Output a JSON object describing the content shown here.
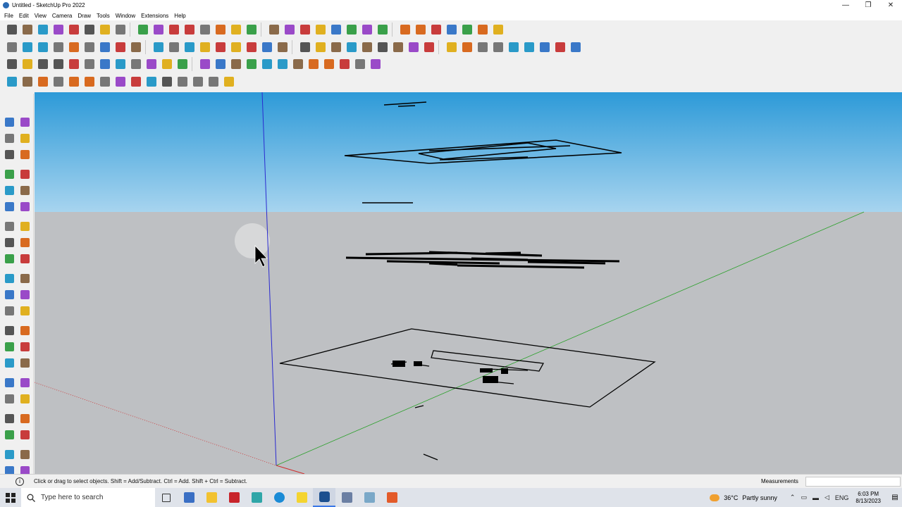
{
  "window": {
    "title": "Untitled - SketchUp Pro 2022",
    "minimize": "—",
    "maximize": "❐",
    "close": "✕"
  },
  "menu": [
    "File",
    "Edit",
    "View",
    "Camera",
    "Draw",
    "Tools",
    "Window",
    "Extensions",
    "Help"
  ],
  "status": {
    "text": "Click or drag to select objects. Shift = Add/Subtract. Ctrl = Add. Shift + Ctrl = Subtract.",
    "measurements_label": "Measurements",
    "measurements_value": ""
  },
  "taskbar": {
    "search_placeholder": "Type here to search",
    "weather_temp": "36°C",
    "weather_text": "Partly sunny",
    "language": "ENG",
    "time": "6:03 PM",
    "date": "8/13/2023"
  },
  "colors": {
    "sky_top": "#2d9ad8",
    "sky_bottom": "#a7d4ef",
    "ground": "#bec0c3",
    "axis_blue": "#2a2ad0",
    "axis_green": "#2aa02a",
    "axis_red": "#d02a2a"
  },
  "icons": {
    "toolbar_1": [
      "zoom-icon",
      "select-icon",
      "eraser-icon",
      "line-icon",
      "arc-icon",
      "rectangle-icon",
      "push-pull-icon",
      "follow-me-icon",
      "move-icon",
      "rotate-icon",
      "scale-icon",
      "tape-measure-icon",
      "text-icon",
      "paint-bucket-icon",
      "orbit-icon",
      "pan-icon",
      "zoom-window-icon",
      "zoom-extents-icon",
      "sandbox-from-contours-icon",
      "sandbox-from-scratch-icon",
      "smoove-icon",
      "stamp-icon",
      "account-icon",
      "warehouse-icon",
      "extension-warehouse-icon",
      "layout-icon",
      "extension-manager-icon",
      "solid-inspector-icon",
      "undo-icon",
      "redo-icon",
      "dynamic-component-icon"
    ],
    "toolbar_2": [
      "components-icon",
      "materials-icon",
      "styles-icon",
      "outer-shell-icon",
      "intersect-icon",
      "union-icon",
      "subtract-icon",
      "trim-icon",
      "split-icon",
      "x-ray-icon",
      "back-edges-icon",
      "wireframe-icon",
      "hidden-line-icon",
      "shaded-icon",
      "shaded-textures-icon",
      "monochrome-icon",
      "iso-view-icon",
      "top-view-icon",
      "front-view-icon",
      "right-view-icon",
      "back-view-icon",
      "left-view-icon",
      "section-plane-icon",
      "display-section-icon",
      "arc-2pt-icon",
      "freehand-icon",
      "polygon-icon",
      "circle-icon",
      "rotated-rectangle-icon",
      "sandbox-drape-icon",
      "add-detail-icon",
      "flip-edge-icon",
      "smooth-icon",
      "shadows-icon",
      "fog-icon",
      "match-photo-icon"
    ],
    "toolbar_3": [
      "face-icon",
      "edge-icon",
      "component-instance-icon",
      "group-icon",
      "tag-icon",
      "scene-icon",
      "outliner-icon",
      "entity-info-icon",
      "soften-icon",
      "fillet-icon",
      "chamfer-icon",
      "curve-icon",
      "3d-text-icon",
      "sandbox-icon",
      "explode-icon",
      "reverse-faces-icon",
      "weld-icon",
      "make-unique-icon",
      "position-camera-icon",
      "walk-icon",
      "look-around-icon",
      "section-fill-icon",
      "grid-icon",
      "selection-toys-icon"
    ],
    "toolbar_4": [
      "round-corner-icon",
      "bezier-icon",
      "joint-push-pull-icon",
      "fredo-scale-icon",
      "curviloft-icon",
      "tools-on-surface-icon",
      "shape-bender-icon",
      "vertex-tools-icon",
      "solid-tools-icon",
      "profile-builder-icon",
      "wrap-icon",
      "extrude-icon",
      "loft-icon",
      "split-tools-icon",
      "hatch-icon"
    ]
  }
}
